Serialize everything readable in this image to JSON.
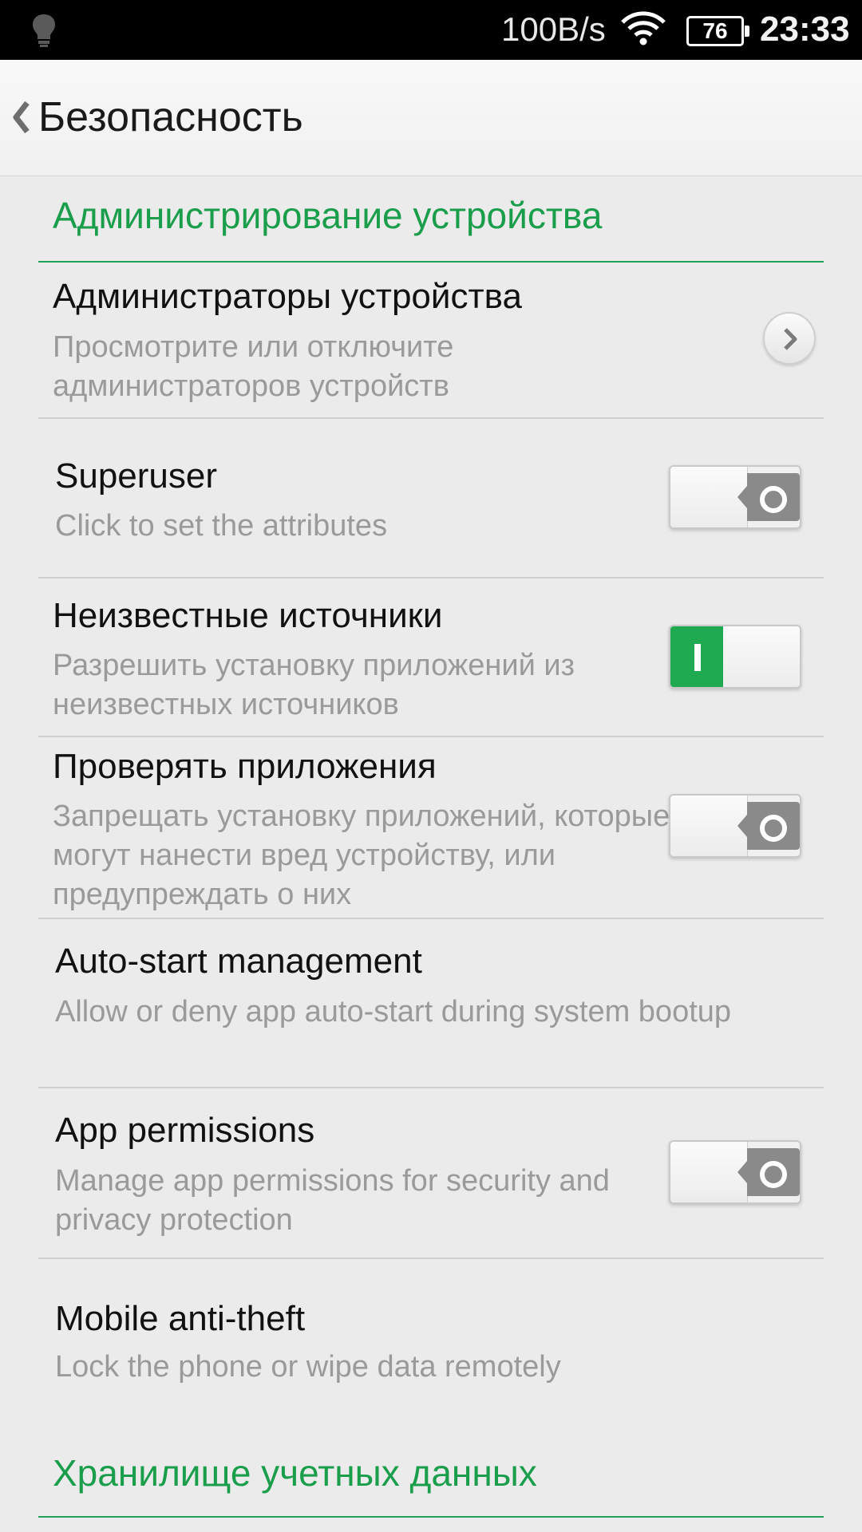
{
  "status_bar": {
    "speed": "100B/s",
    "battery": "76",
    "time": "23:33",
    "icons": [
      "bulb-icon",
      "wifi-icon",
      "battery-icon"
    ]
  },
  "header": {
    "back_icon": "chevron-left-icon",
    "title": "Безопасность"
  },
  "sections": {
    "device_admin": "Администрирование устройства",
    "credential_storage": "Хранилище учетных данных"
  },
  "rows": [
    {
      "title": "Администраторы устройства",
      "summary": "Просмотрите или отключите администраторов устройств",
      "control": "chevron"
    },
    {
      "title": "Superuser",
      "summary": "Click to set the attributes",
      "control": "switch",
      "checked": false
    },
    {
      "title": "Неизвестные источники",
      "summary": "Разрешить установку приложений из неизвестных источников",
      "control": "switch",
      "checked": true
    },
    {
      "title": "Проверять приложения",
      "summary": "Запрещать установку приложений, которые могут нанести вред устройству, или предупреждать о них",
      "control": "switch",
      "checked": false
    },
    {
      "title": "Auto-start management",
      "summary": "Allow or deny app auto-start during system bootup",
      "control": "none"
    },
    {
      "title": "App permissions",
      "summary": "Manage app permissions for security and privacy protection",
      "control": "switch",
      "checked": false
    },
    {
      "title": "Mobile anti-theft",
      "summary": "Lock the phone or wipe data remotely",
      "control": "none"
    }
  ],
  "colors": {
    "accent": "#1a9e4b",
    "switch_on": "#1faa52",
    "switch_off_knob": "#8a8a8a"
  }
}
